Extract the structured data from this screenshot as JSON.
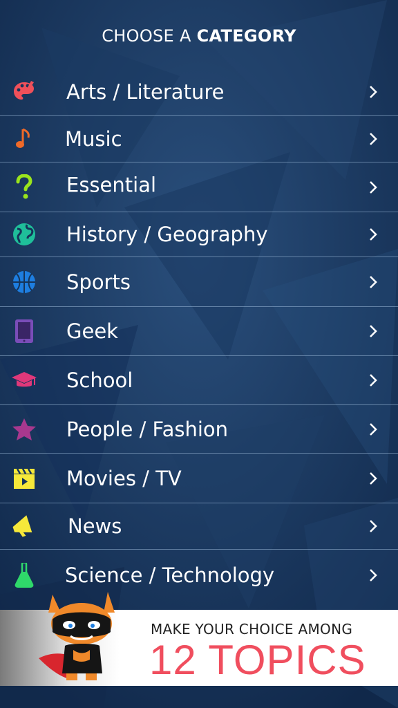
{
  "header": {
    "prefix": "CHOOSE A",
    "bold": "CATEGORY"
  },
  "categories": [
    {
      "label": "Arts / Literature",
      "icon": "palette-icon",
      "color": "#f0505a"
    },
    {
      "label": "Music",
      "icon": "music-note-icon",
      "color": "#f06a28"
    },
    {
      "label": "Essential",
      "icon": "question-mark-icon",
      "color": "#9ae41c"
    },
    {
      "label": "History / Geography",
      "icon": "globe-icon",
      "color": "#1fbf9a"
    },
    {
      "label": "Sports",
      "icon": "basketball-icon",
      "color": "#1e7ee0"
    },
    {
      "label": "Geek",
      "icon": "tablet-icon",
      "color": "#7a4db8"
    },
    {
      "label": "School",
      "icon": "graduation-cap-icon",
      "color": "#e0387a"
    },
    {
      "label": "People / Fashion",
      "icon": "star-icon",
      "color": "#a8388e"
    },
    {
      "label": "Movies / TV",
      "icon": "clapperboard-icon",
      "color": "#f6e83a"
    },
    {
      "label": "News",
      "icon": "megaphone-icon",
      "color": "#f6e83a"
    },
    {
      "label": "Science / Technology",
      "icon": "flask-icon",
      "color": "#2fd86a"
    }
  ],
  "banner": {
    "line1": "MAKE YOUR CHOICE AMONG",
    "line2": "12 TOPICS"
  }
}
